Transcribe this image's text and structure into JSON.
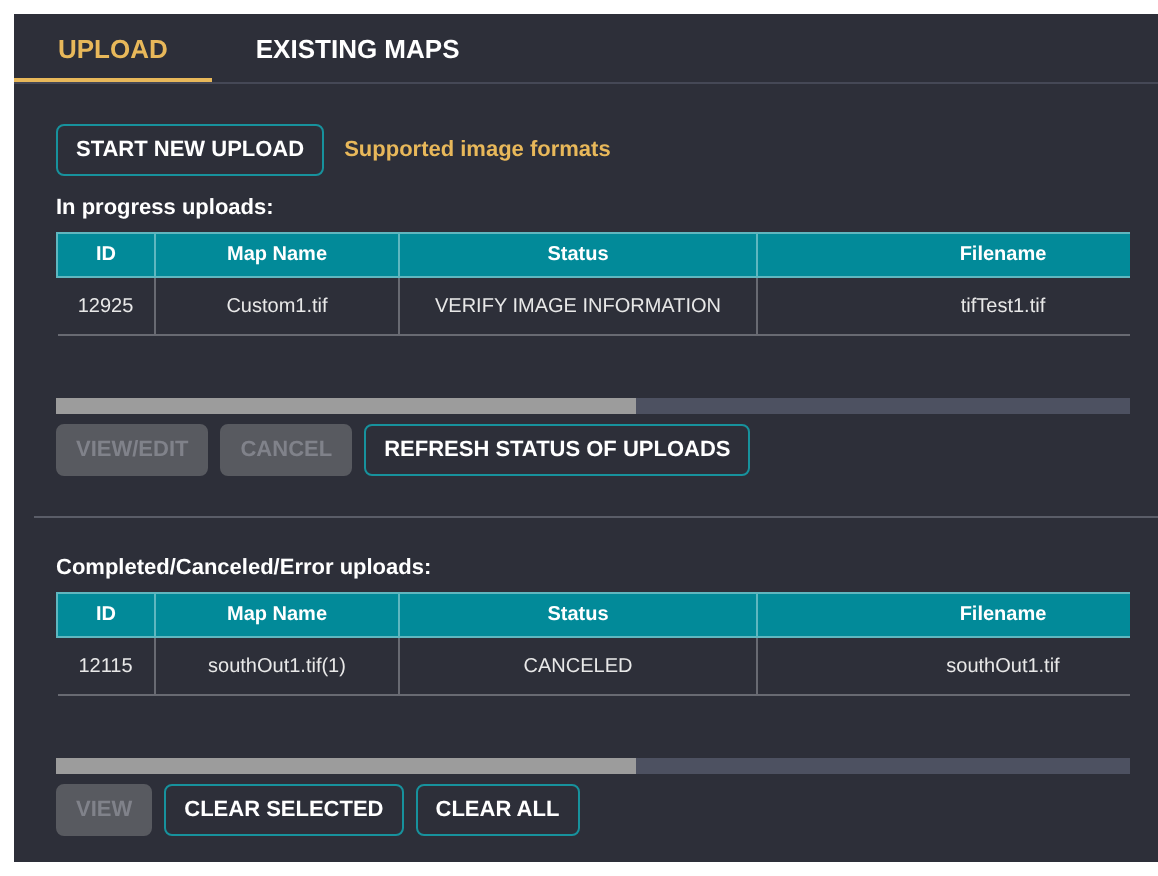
{
  "tabs": [
    {
      "label": "UPLOAD",
      "selected": true
    },
    {
      "label": "EXISTING MAPS",
      "selected": false
    }
  ],
  "start_button": "START NEW UPLOAD",
  "formats_link": "Supported image formats",
  "sections": [
    {
      "title": "In progress uploads:",
      "columns": [
        "ID",
        "Map Name",
        "Status",
        "Filename"
      ],
      "rows": [
        [
          "12925",
          "Custom1.tif",
          "VERIFY IMAGE INFORMATION",
          "tifTest1.tif"
        ]
      ],
      "buttons": [
        {
          "label": "VIEW/EDIT",
          "disabled": true
        },
        {
          "label": "CANCEL",
          "disabled": true
        },
        {
          "label": "REFRESH STATUS OF UPLOADS",
          "disabled": false
        }
      ]
    },
    {
      "title": "Completed/Canceled/Error uploads:",
      "columns": [
        "ID",
        "Map Name",
        "Status",
        "Filename"
      ],
      "rows": [
        [
          "12115",
          "southOut1.tif(1)",
          "CANCELED",
          "southOut1.tif"
        ]
      ],
      "buttons": [
        {
          "label": "VIEW",
          "disabled": true
        },
        {
          "label": "CLEAR SELECTED",
          "disabled": false
        },
        {
          "label": "CLEAR ALL",
          "disabled": false
        }
      ]
    }
  ]
}
